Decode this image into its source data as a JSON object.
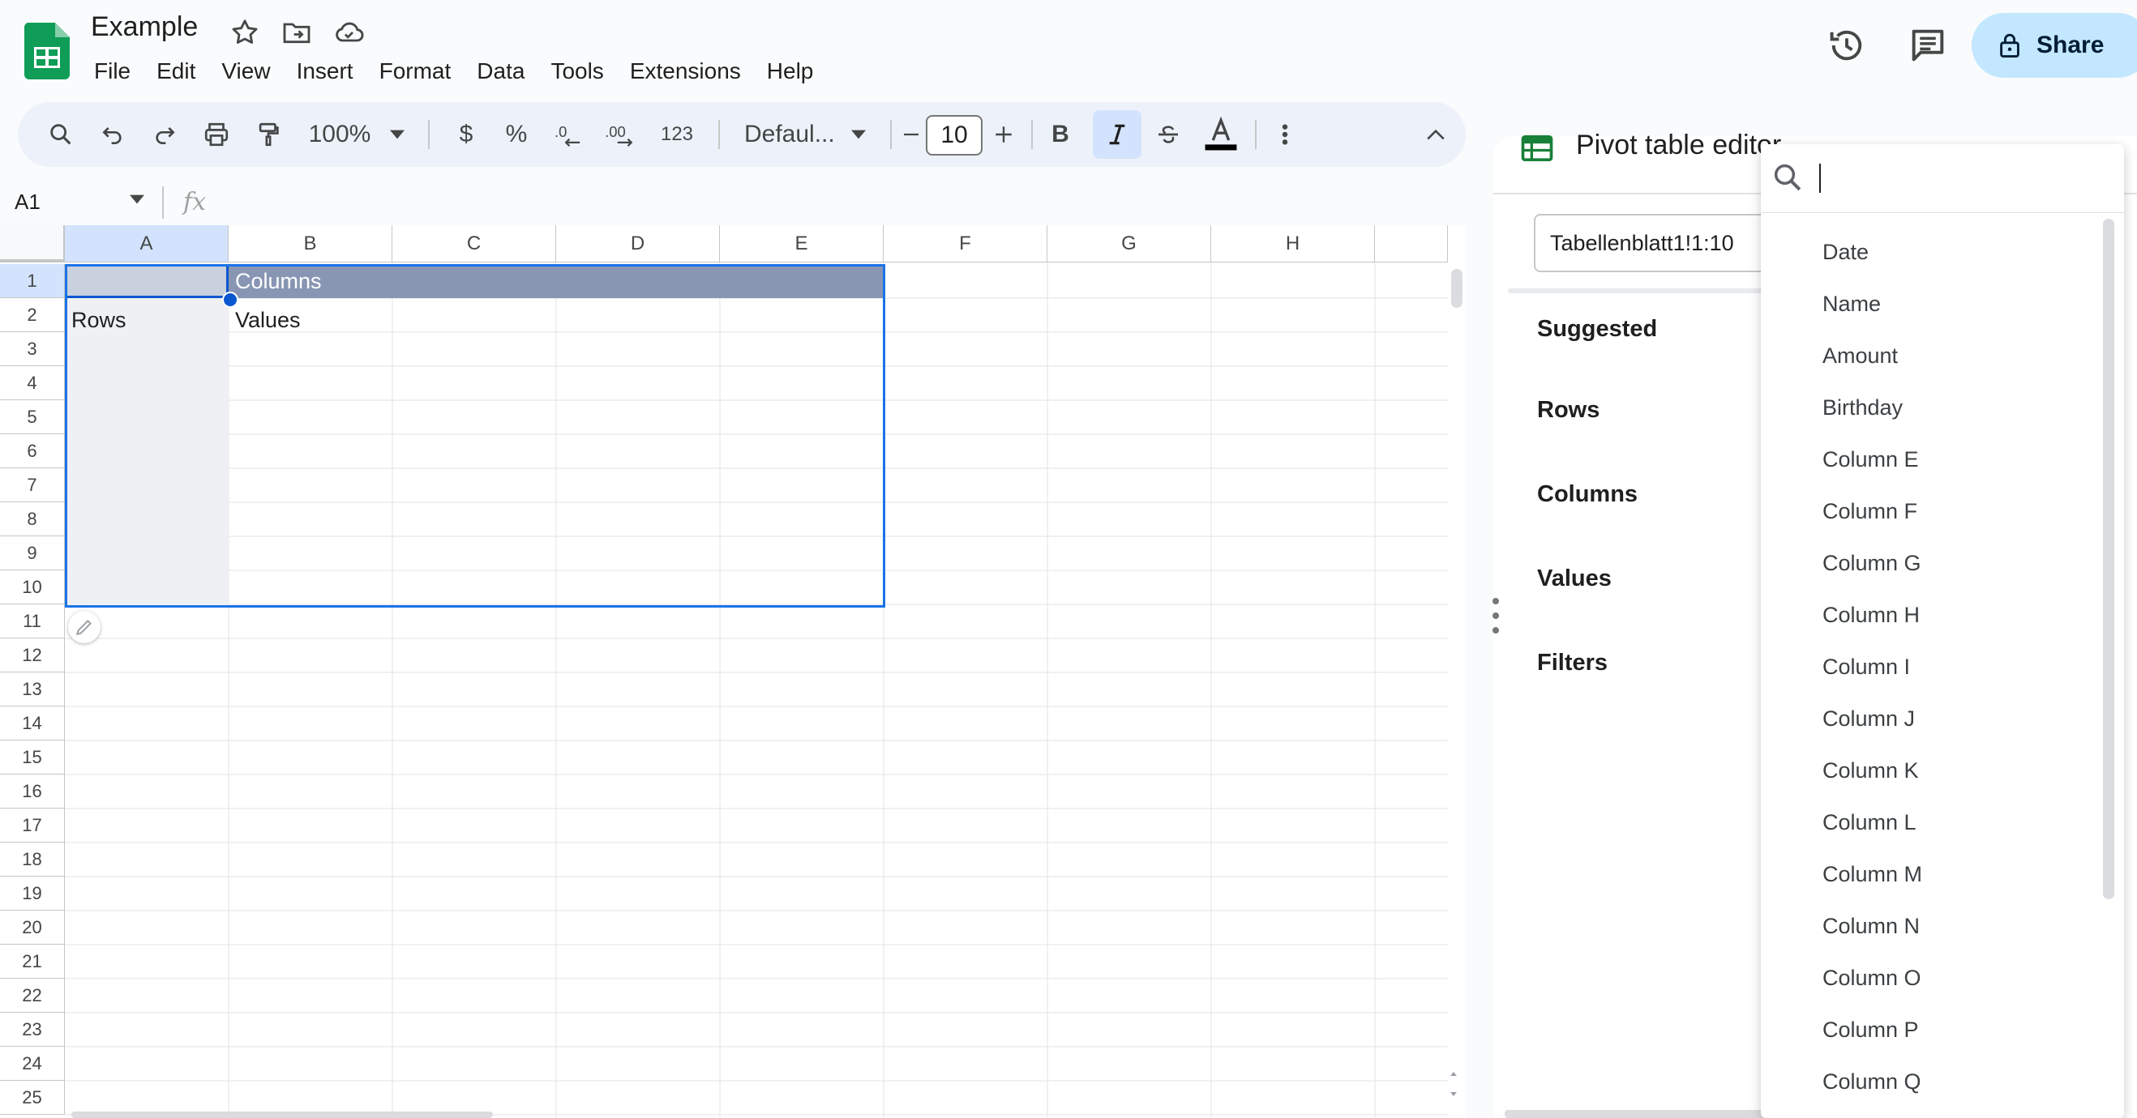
{
  "app": {
    "doc_title": "Example",
    "menu": [
      "File",
      "Edit",
      "View",
      "Insert",
      "Format",
      "Data",
      "Tools",
      "Extensions",
      "Help"
    ],
    "share_label": "Share"
  },
  "toolbar": {
    "zoom": "100%",
    "currency": "$",
    "percent": "%",
    "number_format": "123",
    "font": "Defaul...",
    "font_size": "10",
    "bold": "B"
  },
  "formula_bar": {
    "name_box": "A1",
    "fx": "fx"
  },
  "grid": {
    "columns": [
      "A",
      "B",
      "C",
      "D",
      "E",
      "F",
      "G",
      "H"
    ],
    "rows": [
      "1",
      "2",
      "3",
      "4",
      "5",
      "6",
      "7",
      "8",
      "9",
      "10",
      "11",
      "12",
      "13",
      "14",
      "15",
      "16",
      "17",
      "18",
      "19",
      "20",
      "21",
      "22",
      "23",
      "24",
      "25"
    ],
    "cells": {
      "B1": "Columns",
      "A2": "Rows",
      "B2": "Values"
    }
  },
  "pivot_editor": {
    "title": "Pivot table editor",
    "range": "Tabellenblatt1!1:10",
    "sections": [
      "Suggested",
      "Rows",
      "Columns",
      "Values",
      "Filters"
    ]
  },
  "field_dropdown": {
    "search_value": "",
    "items": [
      "Date",
      "Name",
      "Amount",
      "Birthday",
      "Column E",
      "Column F",
      "Column G",
      "Column H",
      "Column I",
      "Column J",
      "Column K",
      "Column L",
      "Column M",
      "Column N",
      "Column O",
      "Column P",
      "Column Q"
    ]
  },
  "colors": {
    "accent": "#0b57d0",
    "share_bg": "#c2e7ff",
    "header_band": "#8896b3",
    "sheets_green": "#0f9d58"
  }
}
